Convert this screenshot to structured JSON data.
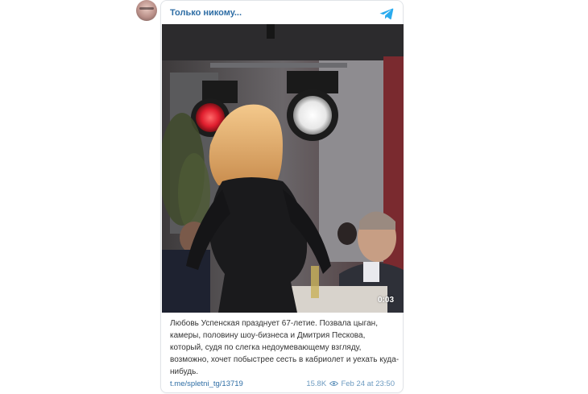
{
  "channel": {
    "name": "Только никому...",
    "colors": {
      "link": "#2f6ea5",
      "telegram": "#2aabee"
    }
  },
  "video": {
    "duration": "0:03"
  },
  "post": {
    "text": "Любовь Успенская празднует 67-летие. Позвала цыган, камеры, половину шоу-бизнеса и Дмитрия Пескова, который, судя по слегка недоумевающему взгляду, возможно, хочет побыстрее сесть в кабриолет и уехать куда-нибудь."
  },
  "footer": {
    "link": "t.me/spletni_tg/13719",
    "views": "15.8K",
    "date": "Feb 24 at 23:50"
  },
  "icons": {
    "telegram": "telegram-icon",
    "views": "eye-icon",
    "play": "video-preview"
  }
}
